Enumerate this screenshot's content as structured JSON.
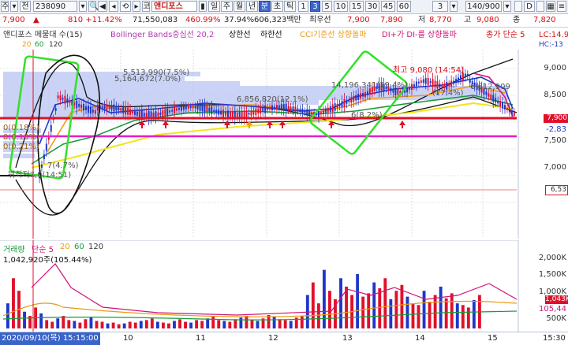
{
  "toolbar": {
    "market": "주",
    "prev_label": "전",
    "code": "238090",
    "stock_name": "앤디포스",
    "periods": [
      "일",
      "주",
      "월",
      "년",
      "분",
      "초",
      "틱"
    ],
    "selected_period": "분",
    "intervals": [
      "1",
      "3",
      "5",
      "10",
      "15",
      "30",
      "45",
      "60"
    ],
    "selected_interval": "3",
    "count_value": "3",
    "range_value": "140/900",
    "right_flag": "D"
  },
  "price_row": {
    "price": "7,900",
    "change": "810 +11.42%",
    "volume": "71,550,083",
    "vol_ratio": "460.99%",
    "turnover": "37.94%",
    "amount": "606,323백만",
    "best_ask_label": "최우선",
    "ask": "7,900",
    "bid": "7,890",
    "low_label": "저",
    "low": "8,770",
    "high_label": "고",
    "high": "9,080",
    "close_label": "종",
    "close": "7,820"
  },
  "legend": {
    "title": "앤디포스 메물대 수(15)",
    "bollinger": "Bollinger Bands중심선 20,2",
    "upper": "상한선",
    "lower": "하한선",
    "cci": "CCI기준선 상향돌파",
    "di": "DI+가 DI-를 상향돌파",
    "ma_title": "종가 단순 5",
    "ma_periods": [
      "20",
      "60",
      "120"
    ],
    "lc": "LC:14.9",
    "hc": "HC:-13"
  },
  "chart_data": {
    "type": "candlestick",
    "y_ticks": [
      "9,000",
      "8,500",
      "8,000",
      "7,500",
      "7,000",
      "6,500"
    ],
    "current_price_tag": "7,900",
    "pct_tag": "-2,83",
    "lower_tag": "6,53",
    "annotations": {
      "high_note": "최고 9,080 (14:54)",
      "vp1": "5,513,990(7.5%)",
      "vp2": "5,164,672(7.0%)",
      "vp3": "6,856,820(12.1%)",
      "vp4": "14,196,341(19.4%)",
      "vp5": "(17.4%)",
      "vp6": "6,612,909",
      "vp7": "6(8.2%)",
      "low_note": "7(4.7%)",
      "left_note": "뭐최저7,0(14:51)",
      "lv1": "0(0.18%)",
      "lv2": "0(0.13%)",
      "lv3": "0(0.21%)"
    },
    "ylim": [
      6400,
      9200
    ]
  },
  "volume": {
    "title": "거래량",
    "ma_label": "단순 5",
    "ma_periods": [
      "20",
      "60",
      "120"
    ],
    "summary": "1,042,920주(105.44%)",
    "ticks": [
      "2,000K",
      "1,500K",
      "1,000K",
      "500K"
    ],
    "tag_value": "1,043K",
    "tag_value2": "105,44",
    "bars": [
      30,
      60,
      45,
      20,
      15,
      25,
      18,
      10,
      8,
      12,
      15,
      10,
      9,
      7,
      11,
      13,
      9,
      8,
      6,
      7,
      5,
      6,
      8,
      7,
      9,
      10,
      12,
      8,
      7,
      6,
      9,
      11,
      8,
      7,
      10,
      9,
      12,
      14,
      10,
      9,
      8,
      11,
      13,
      15,
      10,
      9,
      12,
      16,
      14,
      11,
      10,
      9,
      13,
      15,
      40,
      55,
      30,
      70,
      45,
      35,
      60,
      50,
      40,
      65,
      38,
      42,
      55,
      48,
      60,
      35,
      45,
      52,
      38,
      30,
      28,
      45,
      32,
      40,
      50,
      36,
      42,
      30,
      28,
      25,
      34,
      40
    ]
  },
  "axis": {
    "start_date": "2020/09/10(목) 15:15:00",
    "labels": [
      "10",
      "11",
      "12",
      "13",
      "14",
      "15"
    ],
    "end_time": "15:30"
  }
}
